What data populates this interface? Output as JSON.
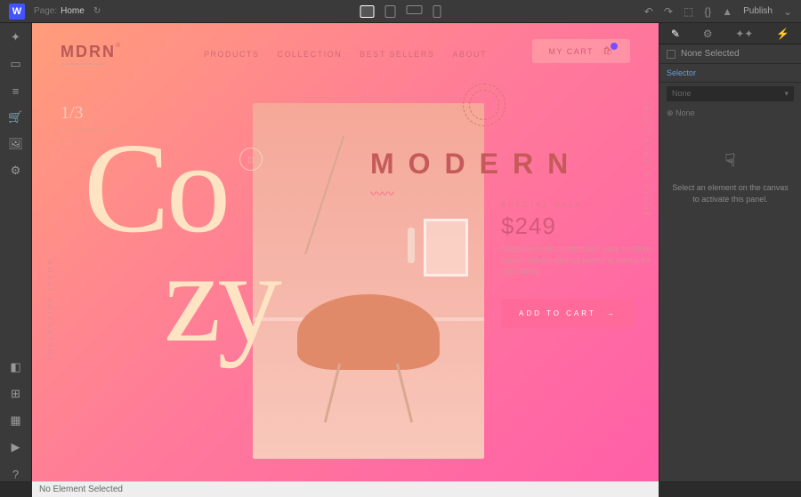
{
  "topbar": {
    "page_label": "Page:",
    "page_name": "Home",
    "publish": "Publish"
  },
  "rightpanel": {
    "none_selected": "None Selected",
    "selector_label": "Selector",
    "selector_value": "None",
    "breadcrumb": "None",
    "placeholder_text": "Select an element on the canvas to activate this panel."
  },
  "bottombar": {
    "status": "No Element Selected"
  },
  "site": {
    "logo": "MDRN",
    "nav": {
      "products": "PRODUCTS",
      "collection": "COLLECTION",
      "bestsellers": "BEST SELLERS",
      "about": "ABOUT"
    },
    "cart_label": "MY CART",
    "counter": {
      "num": "1/3",
      "sub1": "ECOMMERCE",
      "sub2": "TEMPLATE"
    },
    "hero_text_line1": "Co",
    "hero_text_line2": "zy",
    "modern_title": "MODERN",
    "sale": {
      "label": "SPECIAL SALE",
      "price": "$249",
      "desc": "Combined with comfortable, easy furniture makes this the perfect weekend retreat for your family",
      "button": "ADD TO CART",
      "arrow": "→"
    },
    "side_text": "ABOUT SAMPLE STORE",
    "side_text2": "COLLECTION ITEMS"
  }
}
